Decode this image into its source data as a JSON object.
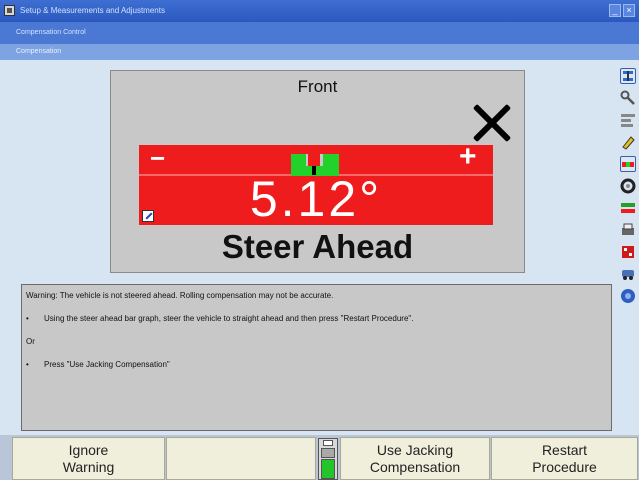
{
  "window": {
    "title": "Setup & Measurements and Adjustments",
    "subtitle": "Compensation Control",
    "section": "Compensation"
  },
  "display": {
    "front_label": "Front",
    "status_icon": "x-icon",
    "minus_label": "−",
    "plus_label": "+",
    "reading": "5.12°",
    "steer_ahead_value": 5.12,
    "status_text": "Steer Ahead"
  },
  "message": {
    "warning": "Warning:  The vehicle is not steered ahead.  Rolling compensation may not be accurate.",
    "bullet1_mark": "•",
    "bullet1": "Using the steer ahead bar graph, steer the vehicle to straight ahead and then press \"Restart Procedure\".",
    "or": "Or",
    "bullet2_mark": "•",
    "bullet2": "Press \"Use Jacking Compensation\""
  },
  "toolbar": {
    "icons": [
      "alignment-icon",
      "wrench-icon",
      "spec-icon",
      "pencil-icon",
      "bar-icon",
      "wheel-icon",
      "gauge-icon",
      "printer-icon",
      "flag-icon",
      "car-icon",
      "help-icon"
    ]
  },
  "buttons": {
    "ignore_line1": "Ignore",
    "ignore_line2": "Warning",
    "jacking_line1": "Use Jacking",
    "jacking_line2": "Compensation",
    "restart_line1": "Restart",
    "restart_line2": "Procedure"
  },
  "colors": {
    "bar_red": "#ee1c1c",
    "target_green": "#22d12a",
    "button_bg": "#efefdc"
  }
}
